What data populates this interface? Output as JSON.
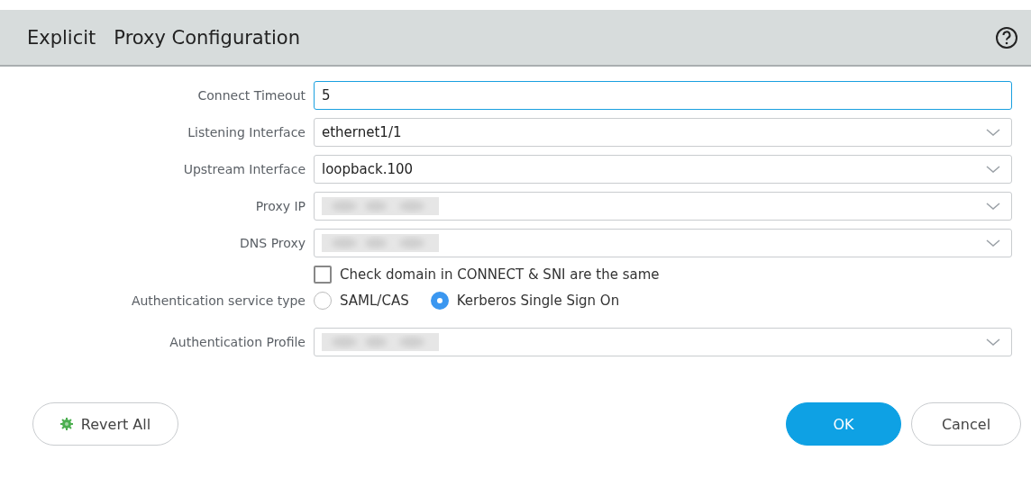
{
  "dialog": {
    "title": "Explicit   Proxy Configuration"
  },
  "fields": [
    {
      "label": "Connect Timeout",
      "kind": "text",
      "value": "5",
      "focused": true,
      "redacted": false
    },
    {
      "label": "Listening Interface",
      "kind": "select",
      "value": "ethernet1/1",
      "focused": false,
      "redacted": false
    },
    {
      "label": "Upstream Interface",
      "kind": "select",
      "value": "loopback.100",
      "focused": false,
      "redacted": false
    },
    {
      "label": "Proxy IP",
      "kind": "select",
      "focused": false,
      "redacted": true
    },
    {
      "label": "DNS Proxy",
      "kind": "select",
      "focused": false,
      "redacted": true
    }
  ],
  "check_domain": {
    "label": "Check domain in CONNECT & SNI are the same",
    "checked": false
  },
  "auth_service": {
    "label": "Authentication service type",
    "options": [
      {
        "label": "SAML/CAS",
        "selected": false
      },
      {
        "label": "Kerberos Single Sign On",
        "selected": true
      }
    ]
  },
  "auth_profile": {
    "label": "Authentication Profile",
    "kind": "select",
    "focused": false,
    "redacted": true
  },
  "buttons": {
    "revert": "Revert All",
    "ok": "OK",
    "cancel": "Cancel"
  }
}
